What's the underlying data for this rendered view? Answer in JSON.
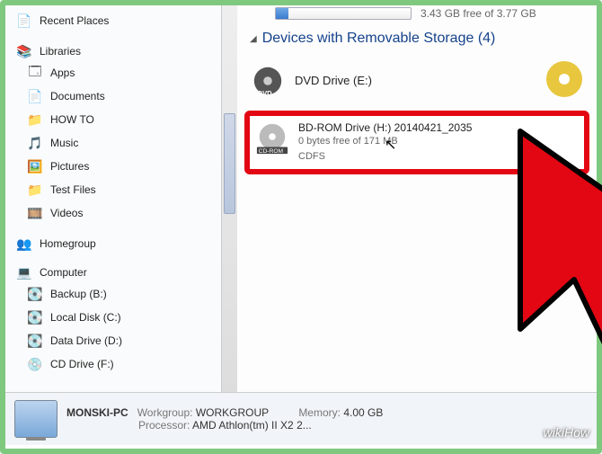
{
  "sidebar": {
    "recent": "Recent Places",
    "libraries": "Libraries",
    "items": [
      "Apps",
      "Documents",
      "HOW TO",
      "Music",
      "Pictures",
      "Test Files",
      "Videos"
    ],
    "homegroup": "Homegroup",
    "computer": "Computer",
    "drives": [
      "Backup (B:)",
      "Local Disk (C:)",
      "Data Drive (D:)",
      "CD Drive (F:)"
    ]
  },
  "content": {
    "free_text": "3.43 GB free of 3.77 GB",
    "section_title": "Devices with Removable Storage (4)",
    "dvd": "DVD Drive (E:)",
    "bdrom": {
      "title": "BD-ROM Drive (H:) 20140421_2035",
      "free": "0 bytes free of 171 MB",
      "fs": "CDFS"
    }
  },
  "footer": {
    "pc_name": "MONSKI-PC",
    "workgroup_label": "Workgroup:",
    "workgroup": "WORKGROUP",
    "memory_label": "Memory:",
    "memory": "4.00 GB",
    "processor_label": "Processor:",
    "processor": "AMD Athlon(tm) II X2 2..."
  },
  "watermark": "wikiHow"
}
